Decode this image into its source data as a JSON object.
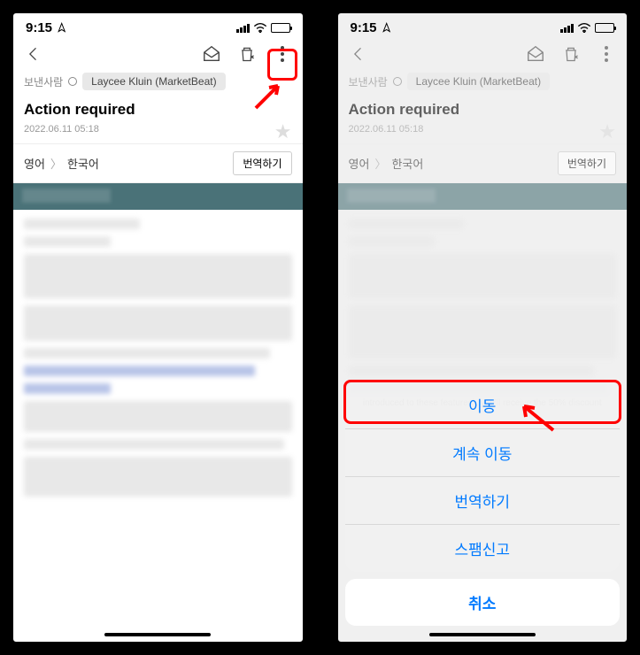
{
  "status": {
    "time": "9:15",
    "location_icon": "➤"
  },
  "sender": {
    "label": "보낸사람",
    "name": "Laycee Kluin (MarketBeat)"
  },
  "email": {
    "subject": "Action required",
    "date": "2022.06.11 05:18"
  },
  "translate": {
    "from": "영어",
    "to": "한국어",
    "button": "번역하기"
  },
  "bottom_text": "introduced to these features), you'll receive the 50% discount",
  "sheet": {
    "items": [
      "이동",
      "계속 이동",
      "번역하기",
      "스팸신고"
    ],
    "cancel": "취소"
  }
}
